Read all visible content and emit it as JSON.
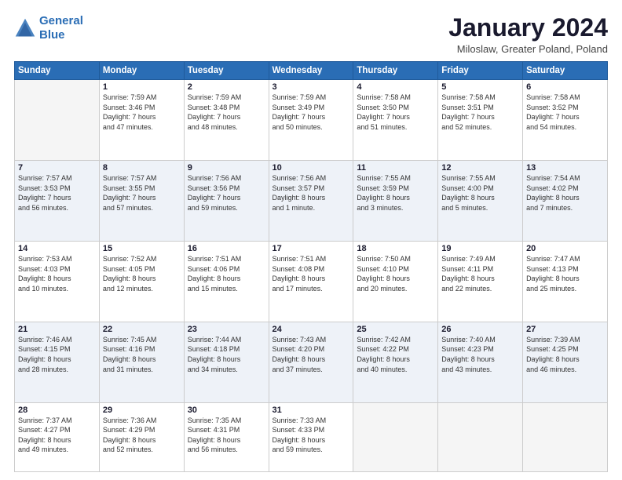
{
  "header": {
    "logo_line1": "General",
    "logo_line2": "Blue",
    "title": "January 2024",
    "subtitle": "Miloslaw, Greater Poland, Poland"
  },
  "weekdays": [
    "Sunday",
    "Monday",
    "Tuesday",
    "Wednesday",
    "Thursday",
    "Friday",
    "Saturday"
  ],
  "weeks": [
    [
      {
        "day": "",
        "sunrise": "",
        "sunset": "",
        "daylight": "",
        "empty": true
      },
      {
        "day": "1",
        "sunrise": "Sunrise: 7:59 AM",
        "sunset": "Sunset: 3:46 PM",
        "daylight": "Daylight: 7 hours and 47 minutes."
      },
      {
        "day": "2",
        "sunrise": "Sunrise: 7:59 AM",
        "sunset": "Sunset: 3:48 PM",
        "daylight": "Daylight: 7 hours and 48 minutes."
      },
      {
        "day": "3",
        "sunrise": "Sunrise: 7:59 AM",
        "sunset": "Sunset: 3:49 PM",
        "daylight": "Daylight: 7 hours and 50 minutes."
      },
      {
        "day": "4",
        "sunrise": "Sunrise: 7:58 AM",
        "sunset": "Sunset: 3:50 PM",
        "daylight": "Daylight: 7 hours and 51 minutes."
      },
      {
        "day": "5",
        "sunrise": "Sunrise: 7:58 AM",
        "sunset": "Sunset: 3:51 PM",
        "daylight": "Daylight: 7 hours and 52 minutes."
      },
      {
        "day": "6",
        "sunrise": "Sunrise: 7:58 AM",
        "sunset": "Sunset: 3:52 PM",
        "daylight": "Daylight: 7 hours and 54 minutes."
      }
    ],
    [
      {
        "day": "7",
        "sunrise": "Sunrise: 7:57 AM",
        "sunset": "Sunset: 3:53 PM",
        "daylight": "Daylight: 7 hours and 56 minutes."
      },
      {
        "day": "8",
        "sunrise": "Sunrise: 7:57 AM",
        "sunset": "Sunset: 3:55 PM",
        "daylight": "Daylight: 7 hours and 57 minutes."
      },
      {
        "day": "9",
        "sunrise": "Sunrise: 7:56 AM",
        "sunset": "Sunset: 3:56 PM",
        "daylight": "Daylight: 7 hours and 59 minutes."
      },
      {
        "day": "10",
        "sunrise": "Sunrise: 7:56 AM",
        "sunset": "Sunset: 3:57 PM",
        "daylight": "Daylight: 8 hours and 1 minute."
      },
      {
        "day": "11",
        "sunrise": "Sunrise: 7:55 AM",
        "sunset": "Sunset: 3:59 PM",
        "daylight": "Daylight: 8 hours and 3 minutes."
      },
      {
        "day": "12",
        "sunrise": "Sunrise: 7:55 AM",
        "sunset": "Sunset: 4:00 PM",
        "daylight": "Daylight: 8 hours and 5 minutes."
      },
      {
        "day": "13",
        "sunrise": "Sunrise: 7:54 AM",
        "sunset": "Sunset: 4:02 PM",
        "daylight": "Daylight: 8 hours and 7 minutes."
      }
    ],
    [
      {
        "day": "14",
        "sunrise": "Sunrise: 7:53 AM",
        "sunset": "Sunset: 4:03 PM",
        "daylight": "Daylight: 8 hours and 10 minutes."
      },
      {
        "day": "15",
        "sunrise": "Sunrise: 7:52 AM",
        "sunset": "Sunset: 4:05 PM",
        "daylight": "Daylight: 8 hours and 12 minutes."
      },
      {
        "day": "16",
        "sunrise": "Sunrise: 7:51 AM",
        "sunset": "Sunset: 4:06 PM",
        "daylight": "Daylight: 8 hours and 15 minutes."
      },
      {
        "day": "17",
        "sunrise": "Sunrise: 7:51 AM",
        "sunset": "Sunset: 4:08 PM",
        "daylight": "Daylight: 8 hours and 17 minutes."
      },
      {
        "day": "18",
        "sunrise": "Sunrise: 7:50 AM",
        "sunset": "Sunset: 4:10 PM",
        "daylight": "Daylight: 8 hours and 20 minutes."
      },
      {
        "day": "19",
        "sunrise": "Sunrise: 7:49 AM",
        "sunset": "Sunset: 4:11 PM",
        "daylight": "Daylight: 8 hours and 22 minutes."
      },
      {
        "day": "20",
        "sunrise": "Sunrise: 7:47 AM",
        "sunset": "Sunset: 4:13 PM",
        "daylight": "Daylight: 8 hours and 25 minutes."
      }
    ],
    [
      {
        "day": "21",
        "sunrise": "Sunrise: 7:46 AM",
        "sunset": "Sunset: 4:15 PM",
        "daylight": "Daylight: 8 hours and 28 minutes."
      },
      {
        "day": "22",
        "sunrise": "Sunrise: 7:45 AM",
        "sunset": "Sunset: 4:16 PM",
        "daylight": "Daylight: 8 hours and 31 minutes."
      },
      {
        "day": "23",
        "sunrise": "Sunrise: 7:44 AM",
        "sunset": "Sunset: 4:18 PM",
        "daylight": "Daylight: 8 hours and 34 minutes."
      },
      {
        "day": "24",
        "sunrise": "Sunrise: 7:43 AM",
        "sunset": "Sunset: 4:20 PM",
        "daylight": "Daylight: 8 hours and 37 minutes."
      },
      {
        "day": "25",
        "sunrise": "Sunrise: 7:42 AM",
        "sunset": "Sunset: 4:22 PM",
        "daylight": "Daylight: 8 hours and 40 minutes."
      },
      {
        "day": "26",
        "sunrise": "Sunrise: 7:40 AM",
        "sunset": "Sunset: 4:23 PM",
        "daylight": "Daylight: 8 hours and 43 minutes."
      },
      {
        "day": "27",
        "sunrise": "Sunrise: 7:39 AM",
        "sunset": "Sunset: 4:25 PM",
        "daylight": "Daylight: 8 hours and 46 minutes."
      }
    ],
    [
      {
        "day": "28",
        "sunrise": "Sunrise: 7:37 AM",
        "sunset": "Sunset: 4:27 PM",
        "daylight": "Daylight: 8 hours and 49 minutes."
      },
      {
        "day": "29",
        "sunrise": "Sunrise: 7:36 AM",
        "sunset": "Sunset: 4:29 PM",
        "daylight": "Daylight: 8 hours and 52 minutes."
      },
      {
        "day": "30",
        "sunrise": "Sunrise: 7:35 AM",
        "sunset": "Sunset: 4:31 PM",
        "daylight": "Daylight: 8 hours and 56 minutes."
      },
      {
        "day": "31",
        "sunrise": "Sunrise: 7:33 AM",
        "sunset": "Sunset: 4:33 PM",
        "daylight": "Daylight: 8 hours and 59 minutes."
      },
      {
        "day": "",
        "sunrise": "",
        "sunset": "",
        "daylight": "",
        "empty": true
      },
      {
        "day": "",
        "sunrise": "",
        "sunset": "",
        "daylight": "",
        "empty": true
      },
      {
        "day": "",
        "sunrise": "",
        "sunset": "",
        "daylight": "",
        "empty": true
      }
    ]
  ]
}
